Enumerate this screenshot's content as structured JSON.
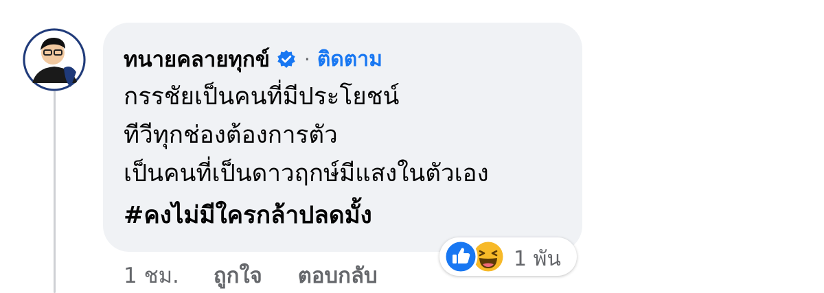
{
  "comment": {
    "author": "ทนายคลายทุกข์",
    "follow_label": "ติดตาม",
    "separator": "·",
    "body_lines": [
      "กรรชัยเป็นคนที่มีประโยชน์",
      "ทีวีทุกช่องต้องการตัว",
      "เป็นคนที่เป็นดาวฤกษ์มีแสงในตัวเอง"
    ],
    "hashtag": "#คงไม่มีใครกล้าปลดมั้ง",
    "reactions": {
      "icons": [
        "like-icon",
        "haha-icon"
      ],
      "count": "1 พัน"
    },
    "actions": {
      "time": "1 ชม.",
      "like": "ถูกใจ",
      "reply": "ตอบกลับ"
    }
  },
  "colors": {
    "bubble": "#f0f2f5",
    "link": "#1877f2",
    "secondary_text": "#65676b",
    "like_blue": "#1877f2",
    "haha_yellow": "#f7b928"
  }
}
